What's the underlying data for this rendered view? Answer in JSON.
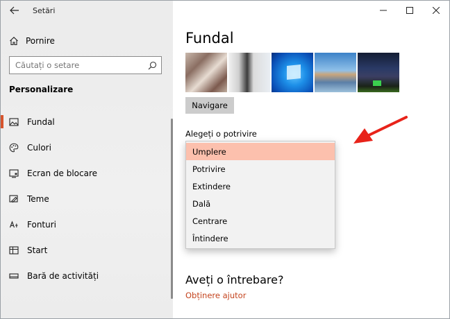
{
  "window": {
    "app_title": "Setări"
  },
  "sidebar": {
    "home_label": "Pornire",
    "search_placeholder": "Căutați o setare",
    "section_title": "Personalizare",
    "items": [
      {
        "label": "Fundal",
        "icon": "picture-icon",
        "active": true
      },
      {
        "label": "Culori",
        "icon": "palette-icon",
        "active": false
      },
      {
        "label": "Ecran de blocare",
        "icon": "lock-screen-icon",
        "active": false
      },
      {
        "label": "Teme",
        "icon": "brush-icon",
        "active": false
      },
      {
        "label": "Fonturi",
        "icon": "font-icon",
        "active": false
      },
      {
        "label": "Start",
        "icon": "start-menu-icon",
        "active": false
      },
      {
        "label": "Bară de activități",
        "icon": "taskbar-icon",
        "active": false
      }
    ]
  },
  "main": {
    "page_title": "Fundal",
    "browse_label": "Navigare",
    "fit_label": "Alegeți o potrivire",
    "fit_options": [
      "Umplere",
      "Potrivire",
      "Extindere",
      "Dală",
      "Centrare",
      "Întindere"
    ],
    "fit_selected": "Umplere",
    "question_title": "Aveți o întrebare?",
    "help_link": "Obținere ajutor"
  },
  "colors": {
    "accent": "#d6542d",
    "selected_option": "#fcc0ad",
    "link": "#c4441e",
    "annotation_arrow": "#e8231a"
  }
}
